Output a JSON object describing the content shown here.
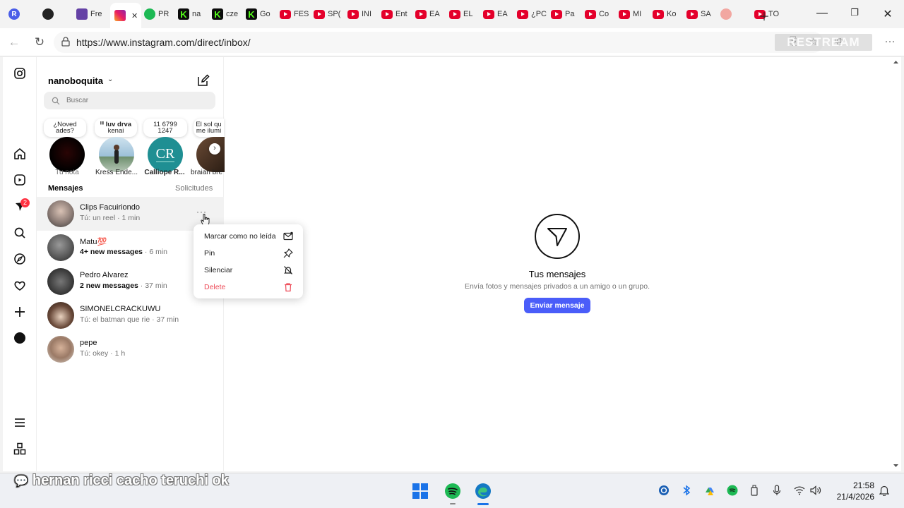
{
  "browser": {
    "tabs": [
      {
        "label": "",
        "icon": "rr"
      },
      {
        "label": "",
        "icon": "dk"
      },
      {
        "label": "Fre",
        "icon": "tw"
      },
      {
        "label": "",
        "icon": "ig",
        "active": true
      },
      {
        "label": "PR",
        "icon": "sp"
      },
      {
        "label": "na",
        "icon": "kk"
      },
      {
        "label": "cze",
        "icon": "kk"
      },
      {
        "label": "Go",
        "icon": "kk"
      },
      {
        "label": "FES",
        "icon": "yt"
      },
      {
        "label": "SP(",
        "icon": "yt"
      },
      {
        "label": "INI",
        "icon": "yt"
      },
      {
        "label": "Ent",
        "icon": "yt"
      },
      {
        "label": "EA",
        "icon": "yt"
      },
      {
        "label": "EL",
        "icon": "yt"
      },
      {
        "label": "EA",
        "icon": "yt"
      },
      {
        "label": "¿PC",
        "icon": "yt"
      },
      {
        "label": "Pa",
        "icon": "yt"
      },
      {
        "label": "Co",
        "icon": "yt"
      },
      {
        "label": "MI",
        "icon": "yt"
      },
      {
        "label": "Ko",
        "icon": "yt"
      },
      {
        "label": "SA",
        "icon": "yt"
      },
      {
        "label": "",
        "icon": "sh"
      },
      {
        "label": "TO",
        "icon": "yt"
      }
    ],
    "url": "https://www.instagram.com/direct/inbox/",
    "watermark": "RESTREAM"
  },
  "inbox": {
    "username": "nanoboquita",
    "search_placeholder": "Buscar",
    "notes": [
      {
        "line1": "¿Noved",
        "line2": "ades?"
      },
      {
        "line1": "ᴵᴵᴵ luv drva",
        "line2": "kenai"
      },
      {
        "line1": "11 6799",
        "line2": "1247"
      },
      {
        "line1": "El sol qu",
        "line2": "me ilumi"
      }
    ],
    "stories": [
      "Tu nota",
      "Kress Ende...",
      "Calliope R...",
      "braian bre"
    ],
    "messages_label": "Mensajes",
    "requests_label": "Solicitudes",
    "conversations": [
      {
        "name": "Clips Facuiriondo",
        "preview": "Tú: un reel · 1 min",
        "time": ""
      },
      {
        "name": "Matu💯",
        "preview": "4+ new messages",
        "time": " · 6 min"
      },
      {
        "name": "Pedro Alvarez",
        "preview": "2 new messages",
        "time": " · 37 min"
      },
      {
        "name": "SIMONELCRACKUWU",
        "preview": "Tú: el batman que rie · 37 min",
        "time": ""
      },
      {
        "name": "pepe",
        "preview": "Tú: okey · 1 h",
        "time": ""
      }
    ],
    "context_menu": {
      "mark_unread": "Marcar como no leída",
      "pin": "Pin",
      "mute": "Silenciar",
      "delete": "Delete"
    },
    "notif_count": "2"
  },
  "empty": {
    "title": "Tus mensajes",
    "subtitle": "Envía fotos y mensajes privados a un amigo o un grupo.",
    "button": "Enviar mensaje"
  },
  "taskbar": {
    "overlay": "hernan ricci cacho teruchi ok",
    "time": "21:58",
    "date": "21/4/2026"
  },
  "colors": {
    "accent": "#4a5df9",
    "danger": "#ed4956",
    "badge": "#ff3040"
  }
}
